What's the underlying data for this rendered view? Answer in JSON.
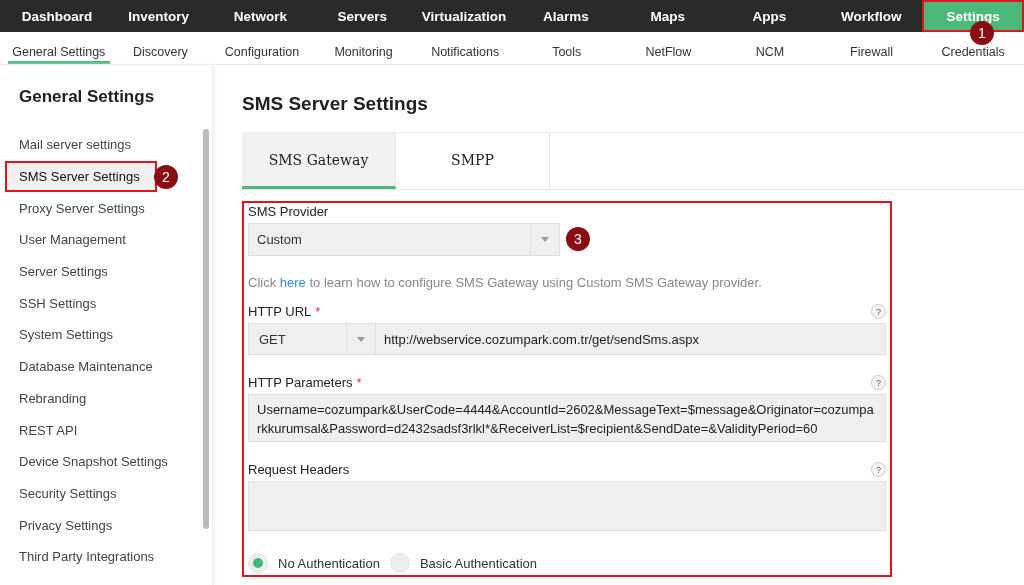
{
  "top_nav": [
    {
      "label": "Dashboard",
      "selected": false,
      "highlighted": false
    },
    {
      "label": "Inventory",
      "selected": false,
      "highlighted": false
    },
    {
      "label": "Network",
      "selected": false,
      "highlighted": false
    },
    {
      "label": "Servers",
      "selected": false,
      "highlighted": false
    },
    {
      "label": "Virtualization",
      "selected": false,
      "highlighted": false
    },
    {
      "label": "Alarms",
      "selected": false,
      "highlighted": false
    },
    {
      "label": "Maps",
      "selected": false,
      "highlighted": false
    },
    {
      "label": "Apps",
      "selected": false,
      "highlighted": false
    },
    {
      "label": "Workflow",
      "selected": false,
      "highlighted": false
    },
    {
      "label": "Settings",
      "selected": true,
      "highlighted": true,
      "step": "1"
    }
  ],
  "sub_nav": [
    {
      "label": "General Settings",
      "selected": true
    },
    {
      "label": "Discovery",
      "selected": false
    },
    {
      "label": "Configuration",
      "selected": false
    },
    {
      "label": "Monitoring",
      "selected": false
    },
    {
      "label": "Notifications",
      "selected": false
    },
    {
      "label": "Tools",
      "selected": false
    },
    {
      "label": "NetFlow",
      "selected": false
    },
    {
      "label": "NCM",
      "selected": false
    },
    {
      "label": "Firewall",
      "selected": false
    },
    {
      "label": "Credentials",
      "selected": false
    }
  ],
  "sidebar": {
    "title": "General Settings",
    "items": [
      {
        "label": "Mail server settings",
        "selected": false,
        "highlighted": false
      },
      {
        "label": "SMS Server Settings",
        "selected": true,
        "highlighted": true,
        "step": "2"
      },
      {
        "label": "Proxy Server Settings",
        "selected": false,
        "highlighted": false
      },
      {
        "label": "User Management",
        "selected": false,
        "highlighted": false
      },
      {
        "label": "Server Settings",
        "selected": false,
        "highlighted": false
      },
      {
        "label": "SSH Settings",
        "selected": false,
        "highlighted": false
      },
      {
        "label": "System Settings",
        "selected": false,
        "highlighted": false
      },
      {
        "label": "Database Maintenance",
        "selected": false,
        "highlighted": false
      },
      {
        "label": "Rebranding",
        "selected": false,
        "highlighted": false
      },
      {
        "label": "REST API",
        "selected": false,
        "highlighted": false
      },
      {
        "label": "Device Snapshot Settings",
        "selected": false,
        "highlighted": false
      },
      {
        "label": "Security Settings",
        "selected": false,
        "highlighted": false
      },
      {
        "label": "Privacy Settings",
        "selected": false,
        "highlighted": false
      },
      {
        "label": "Third Party Integrations",
        "selected": false,
        "highlighted": false
      }
    ]
  },
  "page_title": "SMS Server Settings",
  "tabs": [
    {
      "label": "SMS Gateway",
      "selected": true
    },
    {
      "label": "SMPP",
      "selected": false
    }
  ],
  "form": {
    "highlighted": true,
    "provider": {
      "label": "SMS Provider",
      "value": "Custom",
      "step": "3"
    },
    "help_text": {
      "before": "Click",
      "link": "here",
      "after": "to learn how to configure SMS Gateway using Custom SMS Gateway provider."
    },
    "http_url": {
      "label": "HTTP URL",
      "required_mark": "*",
      "method": "GET",
      "value": "http://webservice.cozumpark.com.tr/get/sendSms.aspx",
      "help": "?"
    },
    "http_parameters": {
      "label": "HTTP Parameters",
      "required_mark": "*",
      "value": "Username=cozumpark&UserCode=4444&AccountId=2602&MessageText=$message&Originator=cozumparkkurumsal&Password=d2432sadsf3rlkl*&ReceiverList=$recipient&SendDate=&ValidityPeriod=60",
      "help": "?"
    },
    "request_headers": {
      "label": "Request Headers",
      "help": "?"
    },
    "authentication": [
      {
        "label": "No Authentication",
        "selected": true
      },
      {
        "label": "Basic Authentication",
        "selected": false
      }
    ]
  }
}
